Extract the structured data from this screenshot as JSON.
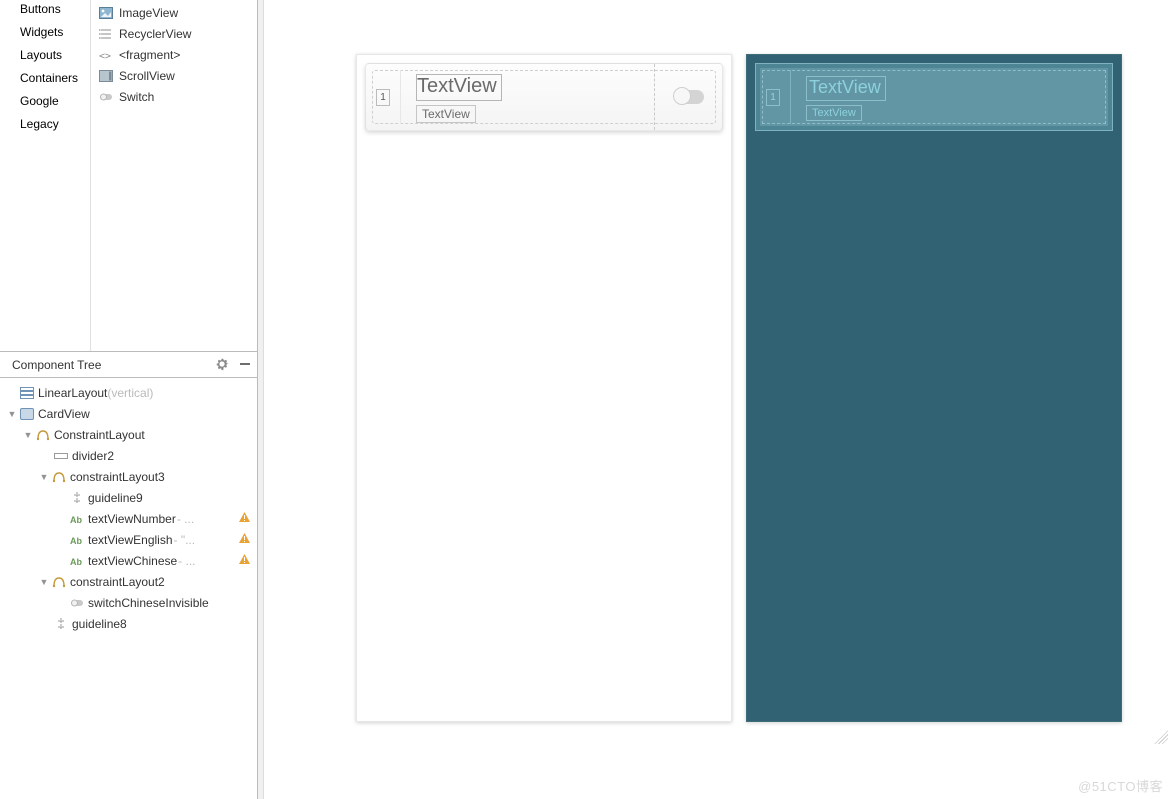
{
  "palette": {
    "categories": [
      "Buttons",
      "Widgets",
      "Layouts",
      "Containers",
      "Google",
      "Legacy"
    ],
    "widgets": [
      {
        "icon": "image-icon",
        "label": "ImageView"
      },
      {
        "icon": "list-icon",
        "label": "RecyclerView"
      },
      {
        "icon": "fragment-icon",
        "label": "<fragment>"
      },
      {
        "icon": "scroll-icon",
        "label": "ScrollView"
      },
      {
        "icon": "switch-icon",
        "label": "Switch"
      }
    ]
  },
  "component_tree": {
    "title": "Component Tree",
    "root": {
      "label": "LinearLayout",
      "suffix": "(vertical)"
    },
    "nodes": {
      "cardview": "CardView",
      "constraintlayout": "ConstraintLayout",
      "divider2": "divider2",
      "constraintlayout3": "constraintLayout3",
      "guideline9": "guideline9",
      "textViewNumber": "textViewNumber",
      "textViewNumber_suffix": "- ...",
      "textViewEnglish": "textViewEnglish",
      "textViewEnglish_suffix": "- \"...",
      "textViewChinese": "textViewChinese",
      "textViewChinese_suffix": "- ...",
      "constraintlayout2": "constraintLayout2",
      "switchChineseInvisible": "switchChineseInvisible",
      "guideline8": "guideline8"
    }
  },
  "design": {
    "preview_tv_big": "TextView",
    "preview_tv_small": "TextView",
    "preview_number": "1",
    "blueprint_tv_big": "TextView",
    "blueprint_tv_small": "TextView",
    "blueprint_number": "1"
  },
  "watermark": "@51CTO博客"
}
